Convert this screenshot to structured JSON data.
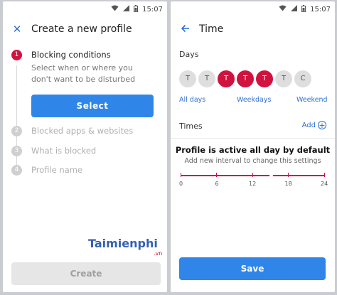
{
  "status": {
    "time": "15:07",
    "icons": [
      "wifi-icon",
      "signal-icon",
      "battery-icon"
    ]
  },
  "left": {
    "title": "Create a new profile",
    "close_icon": "close-icon",
    "steps": [
      {
        "number": "1",
        "label": "Blocking conditions",
        "description": "Select when or where you don't want to be disturbed",
        "state": "active"
      },
      {
        "number": "2",
        "label": "Blocked apps & websites",
        "state": "inactive"
      },
      {
        "number": "3",
        "label": "What is blocked",
        "state": "inactive"
      },
      {
        "number": "4",
        "label": "Profile name",
        "state": "inactive"
      }
    ],
    "select_label": "Select",
    "create_label": "Create",
    "watermark": "Taimienphi",
    "watermark_sub": ".vn"
  },
  "right": {
    "title": "Time",
    "back_icon": "back-arrow-icon",
    "days_label": "Days",
    "days": [
      {
        "letter": "T",
        "selected": false
      },
      {
        "letter": "T",
        "selected": false
      },
      {
        "letter": "T",
        "selected": true
      },
      {
        "letter": "T",
        "selected": true
      },
      {
        "letter": "T",
        "selected": true
      },
      {
        "letter": "T",
        "selected": false
      },
      {
        "letter": "C",
        "selected": false
      }
    ],
    "presets": {
      "all": "All days",
      "weekdays": "Weekdays",
      "weekend": "Weekend"
    },
    "times_label": "Times",
    "add_label": "Add",
    "active_title": "Profile is active all day by default",
    "active_subtitle": "Add new interval to change this settings",
    "timeline_ticks": [
      "0",
      "6",
      "12",
      "18",
      "24"
    ],
    "current_hour": 15.1,
    "save_label": "Save"
  },
  "colors": {
    "accent": "#2f86e8",
    "selected": "#d1123f",
    "link": "#2f6fd6"
  }
}
